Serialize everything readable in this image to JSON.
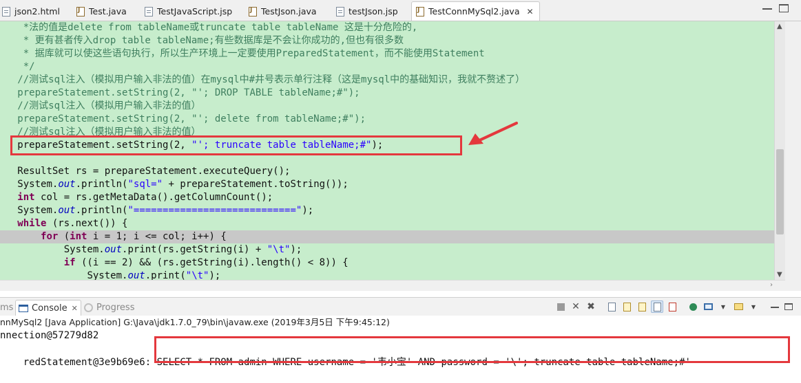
{
  "tabs": [
    {
      "label": "json2.html",
      "icon": "html-file-icon",
      "active": false
    },
    {
      "label": "Test.java",
      "icon": "java-file-icon",
      "active": false
    },
    {
      "label": "TestJavaScript.jsp",
      "icon": "jsp-file-icon",
      "active": false
    },
    {
      "label": "TestJson.java",
      "icon": "java-file-icon",
      "active": false
    },
    {
      "label": "testJson.jsp",
      "icon": "jsp-file-icon",
      "active": false
    },
    {
      "label": "TestConnMySql2.java",
      "icon": "java-file-icon",
      "active": true
    }
  ],
  "editor": {
    "background": "#c7edcc",
    "highlight_color": "#e4383d",
    "lines": [
      {
        "indent": "    ",
        "tokens": [
          {
            "t": "*法的值是delete from tableName或truncate table tableName 这是十分危险的,",
            "c": "cm"
          }
        ]
      },
      {
        "indent": "    ",
        "tokens": [
          {
            "t": "* 更有甚者传入drop table tableName;有些数据库是不会让你成功的,但也有很多数",
            "c": "cm"
          }
        ]
      },
      {
        "indent": "    ",
        "tokens": [
          {
            "t": "* 据库就可以使这些语句执行，所以生产环境上一定要使用PreparedStatement，而不能使用Statement",
            "c": "cm"
          }
        ]
      },
      {
        "indent": "    ",
        "tokens": [
          {
            "t": "*/",
            "c": "cm"
          }
        ]
      },
      {
        "indent": "   ",
        "tokens": [
          {
            "t": "//测试sql注入（模拟用户输入非法的值）在mysql中#井号表示单行注释（这是mysql中的基础知识，我就不赘述了）",
            "c": "cm"
          }
        ]
      },
      {
        "indent": "   ",
        "tokens": [
          {
            "t": "prepareStatement.setString(2, ",
            "c": "cm"
          },
          {
            "t": "\"'; DROP TABLE tableName;#\"",
            "c": "cm"
          },
          {
            "t": ");",
            "c": "cm"
          }
        ]
      },
      {
        "indent": "   ",
        "tokens": [
          {
            "t": "//测试sql注入（模拟用户输入非法的值）",
            "c": "cm"
          }
        ]
      },
      {
        "indent": "   ",
        "tokens": [
          {
            "t": "prepareStatement.setString(2, \"'; delete from tableName;#\");",
            "c": "cm"
          }
        ]
      },
      {
        "indent": "   ",
        "tokens": [
          {
            "t": "//测试sql注入（模拟用户输入非法的值）",
            "c": "cm"
          }
        ]
      },
      {
        "indent": "   ",
        "tokens": [
          {
            "t": "prepareStatement.setString(2, ",
            "c": ""
          },
          {
            "t": "\"'; truncate table tableName;#\"",
            "c": "str"
          },
          {
            "t": ");",
            "c": ""
          }
        ],
        "boxed": true
      },
      {
        "indent": "",
        "tokens": []
      },
      {
        "indent": "   ",
        "tokens": [
          {
            "t": "ResultSet rs = prepareStatement.executeQuery();",
            "c": ""
          }
        ]
      },
      {
        "indent": "   ",
        "tokens": [
          {
            "t": "System.",
            "c": ""
          },
          {
            "t": "out",
            "c": "fld"
          },
          {
            "t": ".println(",
            "c": ""
          },
          {
            "t": "\"sql=\"",
            "c": "str"
          },
          {
            "t": " + prepareStatement.toString());",
            "c": ""
          }
        ]
      },
      {
        "indent": "   ",
        "tokens": [
          {
            "t": "int",
            "c": "kw"
          },
          {
            "t": " col = rs.getMetaData().getColumnCount();",
            "c": ""
          }
        ]
      },
      {
        "indent": "   ",
        "tokens": [
          {
            "t": "System.",
            "c": ""
          },
          {
            "t": "out",
            "c": "fld"
          },
          {
            "t": ".println(",
            "c": ""
          },
          {
            "t": "\"============================\"",
            "c": "str"
          },
          {
            "t": ");",
            "c": ""
          }
        ]
      },
      {
        "indent": "   ",
        "tokens": [
          {
            "t": "while",
            "c": "kw"
          },
          {
            "t": " (rs.next()) {",
            "c": ""
          }
        ]
      },
      {
        "indent": "       ",
        "tokens": [
          {
            "t": "for",
            "c": "kw"
          },
          {
            "t": " (",
            "c": ""
          },
          {
            "t": "int",
            "c": "kw"
          },
          {
            "t": " i = 1; i <= col; i++) {",
            "c": ""
          }
        ],
        "current": true
      },
      {
        "indent": "           ",
        "tokens": [
          {
            "t": "System.",
            "c": ""
          },
          {
            "t": "out",
            "c": "fld"
          },
          {
            "t": ".print(rs.getString(i) + ",
            "c": ""
          },
          {
            "t": "\"\\t\"",
            "c": "str"
          },
          {
            "t": ");",
            "c": ""
          }
        ]
      },
      {
        "indent": "           ",
        "tokens": [
          {
            "t": "if",
            "c": "kw"
          },
          {
            "t": " ((i == 2) && (rs.getString(i).length() < 8)) {",
            "c": ""
          }
        ]
      },
      {
        "indent": "               ",
        "tokens": [
          {
            "t": "System.",
            "c": ""
          },
          {
            "t": "out",
            "c": "fld"
          },
          {
            "t": ".print(",
            "c": ""
          },
          {
            "t": "\"\\t\"",
            "c": "str"
          },
          {
            "t": ");",
            "c": ""
          }
        ]
      }
    ]
  },
  "panel": {
    "tabs": [
      {
        "label": "ms",
        "state": "muted"
      },
      {
        "label": "Console",
        "state": "active"
      },
      {
        "label": "Progress",
        "state": "muted"
      }
    ],
    "header": "nnMySql2 [Java Application] G:\\Java\\jdk1.7.0_79\\bin\\javaw.exe (2019年3月5日 下午9:45:12)",
    "line1": "nnection@57279d82",
    "line2_prefix": "redStatement@3e9b69e6: ",
    "line2_sql": "SELECT * FROM admin WHERE username = '韦小宝' AND password = '\\'; truncate table tableName;#'"
  }
}
